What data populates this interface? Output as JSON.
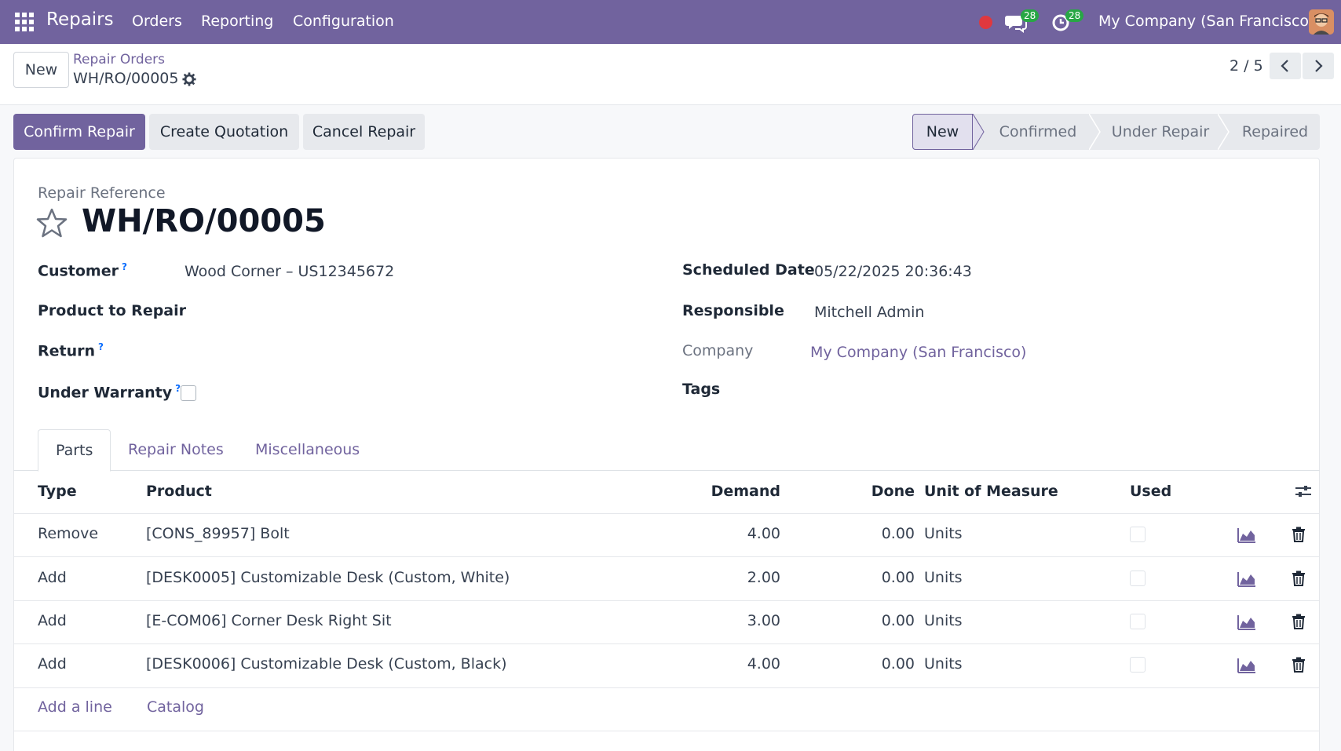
{
  "navbar": {
    "app_name": "Repairs",
    "menus": [
      "Orders",
      "Reporting",
      "Configuration"
    ],
    "messages_badge": "28",
    "activities_badge": "28",
    "company": "My Company (San Francisco)",
    "colors": {
      "brand": "#71639e",
      "badge": "#28a745",
      "record_dot": "#e0383e"
    }
  },
  "control_panel": {
    "new_label": "New",
    "breadcrumb_parent": "Repair Orders",
    "breadcrumb_current": "WH/RO/00005",
    "pager": "2 / 5"
  },
  "actions": {
    "confirm": "Confirm Repair",
    "quotation": "Create Quotation",
    "cancel": "Cancel Repair"
  },
  "status": {
    "stages": [
      "New",
      "Confirmed",
      "Under Repair",
      "Repaired"
    ],
    "active": "New"
  },
  "form": {
    "reference_label": "Repair Reference",
    "reference": "WH/RO/00005",
    "customer_label": "Customer",
    "customer": "Wood Corner – US12345672",
    "product_label": "Product to Repair",
    "return_label": "Return",
    "warranty_label": "Under Warranty",
    "scheduled_label": "Scheduled Date",
    "scheduled": "05/22/2025 20:36:43",
    "responsible_label": "Responsible",
    "responsible": "Mitchell Admin",
    "company_label": "Company",
    "company": "My Company (San Francisco)",
    "tags_label": "Tags",
    "help_mark": "?"
  },
  "tabs": [
    "Parts",
    "Repair Notes",
    "Miscellaneous"
  ],
  "table": {
    "headers": {
      "type": "Type",
      "product": "Product",
      "demand": "Demand",
      "done": "Done",
      "uom": "Unit of Measure",
      "used": "Used"
    },
    "rows": [
      {
        "type": "Remove",
        "product": "[CONS_89957] Bolt",
        "demand": "4.00",
        "done": "0.00",
        "uom": "Units"
      },
      {
        "type": "Add",
        "product": "[DESK0005] Customizable Desk (Custom, White)",
        "demand": "2.00",
        "done": "0.00",
        "uom": "Units"
      },
      {
        "type": "Add",
        "product": "[E-COM06] Corner Desk Right Sit",
        "demand": "3.00",
        "done": "0.00",
        "uom": "Units"
      },
      {
        "type": "Add",
        "product": "[DESK0006] Customizable Desk (Custom, Black)",
        "demand": "4.00",
        "done": "0.00",
        "uom": "Units"
      }
    ],
    "add_line": "Add a line",
    "catalog": "Catalog"
  }
}
